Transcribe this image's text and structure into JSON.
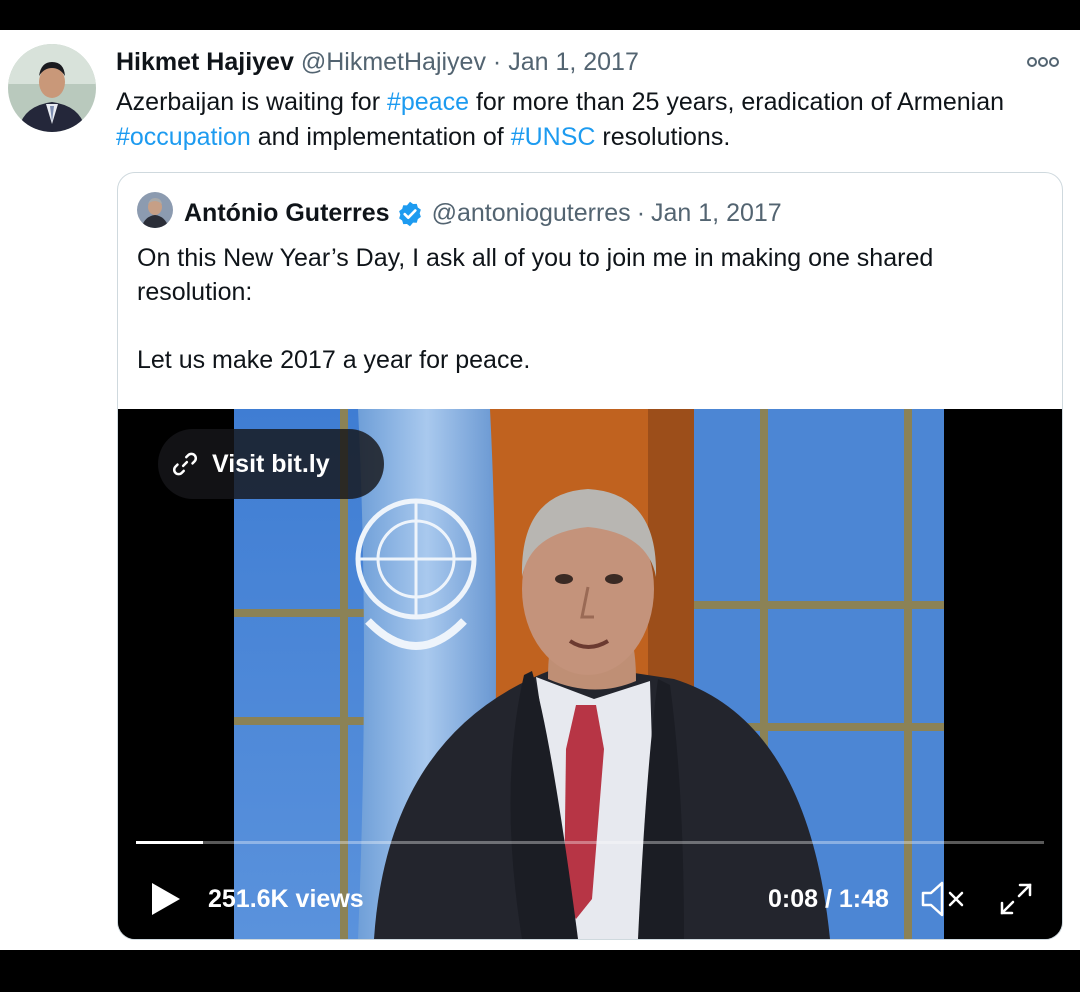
{
  "tweet": {
    "author_name": "Hikmet Hajiyev",
    "handle": "@HikmetHajiyev",
    "separator": "·",
    "date": "Jan 1, 2017",
    "text_segments": [
      "Azerbaijan is waiting for ",
      "#peace",
      " for more than 25 years, eradication of Armenian ",
      "#occupation",
      " and implementation of ",
      "#UNSC",
      " resolutions."
    ]
  },
  "quoted_tweet": {
    "author_name": "António Guterres",
    "verified": true,
    "handle": "@antonioguterres",
    "separator": "·",
    "date": "Jan 1, 2017",
    "paragraphs": [
      "On this New Year’s Day, I ask all of you to join me in making one shared resolution:",
      "Let us make 2017 a year for peace."
    ]
  },
  "video": {
    "link_label": "Visit bit.ly",
    "views": "251.6K views",
    "time": "0:08 / 1:48",
    "progress": 0.074
  },
  "icons": {
    "more": "more-icon",
    "verified": "verified-icon",
    "link": "link-icon",
    "play": "play-icon",
    "mute": "mute-icon",
    "fullscreen": "fullscreen-icon"
  },
  "colors": {
    "hashtag": "#1d9bf0",
    "verified": "#1d9bf0",
    "text": "#0f1419",
    "secondary": "#536471"
  }
}
